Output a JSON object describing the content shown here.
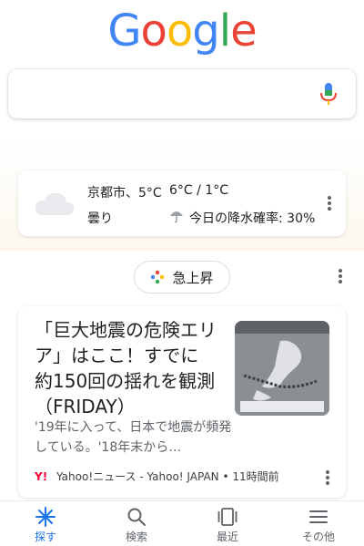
{
  "logo": {
    "letters": [
      "G",
      "o",
      "o",
      "g",
      "l",
      "e"
    ],
    "colors": [
      "#4285F4",
      "#EA4335",
      "#FBBC05",
      "#4285F4",
      "#34A853",
      "#EA4335"
    ]
  },
  "search": {
    "placeholder": "",
    "mic_icon": "mic-icon"
  },
  "weather": {
    "location_temp": "京都市、5°C",
    "high_low": "6°C / 1°C",
    "condition": "曇り",
    "rain_chance": "今日の降水確率: 30%",
    "icons": [
      "cloud-icon",
      "umbrella-icon",
      "more-vert-icon"
    ]
  },
  "trending": {
    "label": "急上昇",
    "icon": "sparkle-icon"
  },
  "news": {
    "title": "「巨大地震の危険エリア」はここ！すでに約150回の揺れを観測（FRIDAY）",
    "snippet": "'19年に入って、日本で地震が頻発している。'18年末から…",
    "source_mark": "Y!",
    "source": "Yahoo!ニュース - Yahoo! JAPAN • 11時間前"
  },
  "bottom_nav": {
    "items": [
      {
        "label": "探す",
        "icon": "discover-icon"
      },
      {
        "label": "検索",
        "icon": "search-icon"
      },
      {
        "label": "最近",
        "icon": "recent-icon"
      },
      {
        "label": "その他",
        "icon": "menu-icon"
      }
    ],
    "active_color": "#1a73e8"
  }
}
